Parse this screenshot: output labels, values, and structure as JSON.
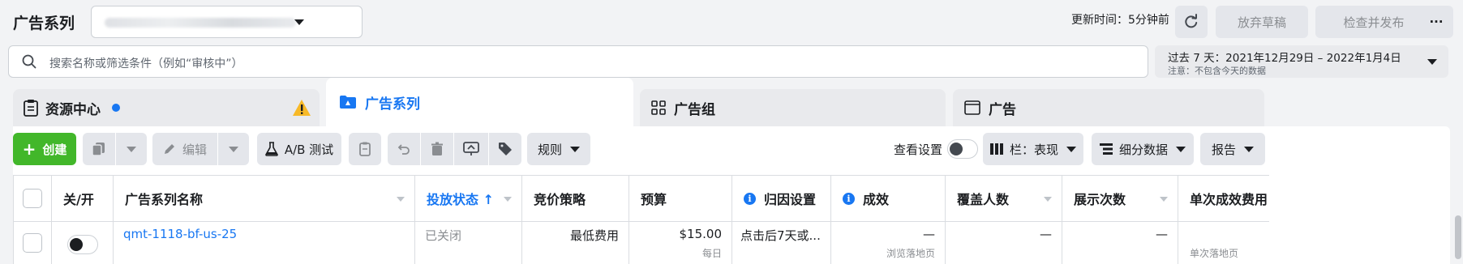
{
  "header": {
    "title": "广告系列",
    "update_label": "更新时间：5分钟前",
    "discard_label": "放弃草稿",
    "publish_label": "检查并发布",
    "more_label": "···"
  },
  "search": {
    "placeholder": "搜索名称或筛选条件（例如“审核中”）"
  },
  "date_range": {
    "main": "过去 7 天：2021年12月29日 – 2022年1月4日",
    "note": "注意：不包含今天的数据"
  },
  "tabs": [
    {
      "label": "资源中心",
      "icon": "clipboard-icon"
    },
    {
      "label": "广告系列",
      "icon": "folder-icon"
    },
    {
      "label": "广告组",
      "icon": "grid-icon"
    },
    {
      "label": "广告",
      "icon": "window-icon"
    }
  ],
  "toolbar": {
    "create_label": "创建",
    "edit_label": "编辑",
    "ab_test_label": "A/B 测试",
    "rules_label": "规则",
    "view_settings_label": "查看设置",
    "columns_label": "栏：表现",
    "breakdown_label": "细分数据",
    "reports_label": "报告"
  },
  "table": {
    "columns": [
      "关/开",
      "广告系列名称",
      "投放状态 ↑",
      "竞价策略",
      "预算",
      "归因设置",
      "成效",
      "覆盖人数",
      "展示次数",
      "单次成效费用"
    ],
    "rows": [
      {
        "name": "qmt-1118-bf-us-25",
        "status": "已关闭",
        "bid_strategy": "最低费用",
        "budget": "$15.00",
        "budget_sub": "每日",
        "attribution": "点击后7天或...",
        "results": "—",
        "results_sub": "浏览落地页",
        "reach": "—",
        "impressions": "—",
        "cost_per_result_sub": "单次落地页"
      }
    ]
  },
  "colors": {
    "accent": "#1877f2",
    "create": "#42b72a",
    "warning": "#f7b928"
  }
}
